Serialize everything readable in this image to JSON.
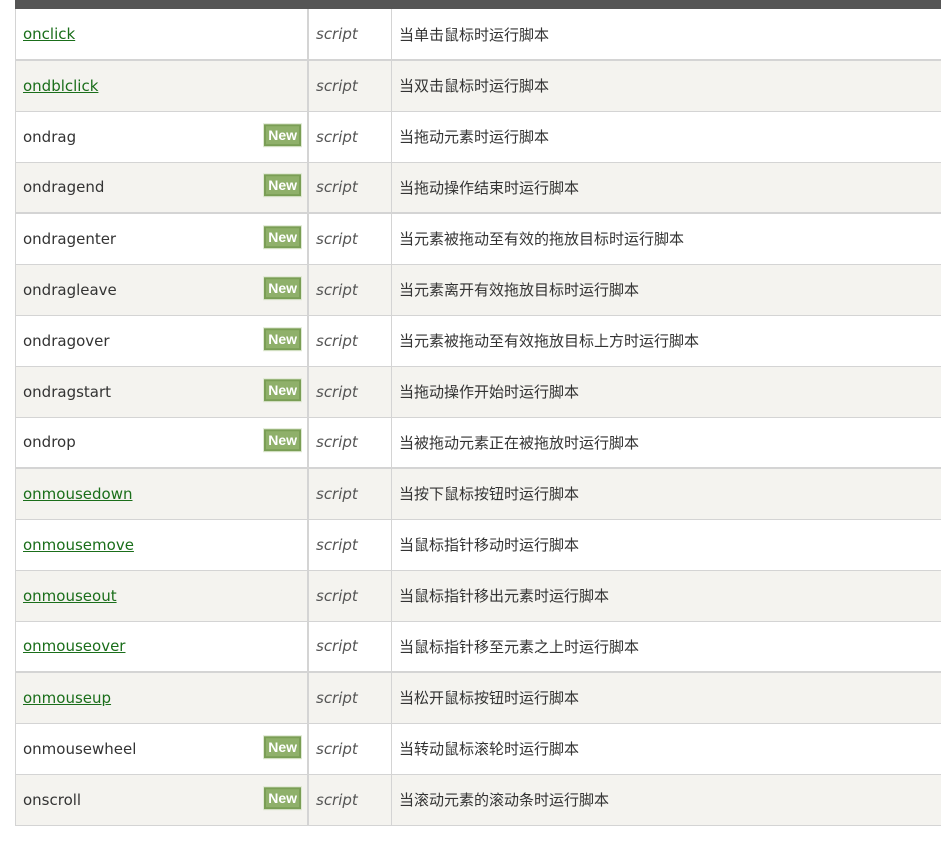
{
  "table": {
    "column_type_hint": "script",
    "rows": [
      {
        "attr": "onclick",
        "link": true,
        "new": false,
        "value": "script",
        "desc": "当单击鼠标时运行脚本"
      },
      {
        "attr": "ondblclick",
        "link": true,
        "new": false,
        "value": "script",
        "desc": "当双击鼠标时运行脚本"
      },
      {
        "attr": "ondrag",
        "link": false,
        "new": true,
        "value": "script",
        "desc": "当拖动元素时运行脚本"
      },
      {
        "attr": "ondragend",
        "link": false,
        "new": true,
        "value": "script",
        "desc": "当拖动操作结束时运行脚本"
      },
      {
        "attr": "ondragenter",
        "link": false,
        "new": true,
        "value": "script",
        "desc": "当元素被拖动至有效的拖放目标时运行脚本"
      },
      {
        "attr": "ondragleave",
        "link": false,
        "new": true,
        "value": "script",
        "desc": "当元素离开有效拖放目标时运行脚本"
      },
      {
        "attr": "ondragover",
        "link": false,
        "new": true,
        "value": "script",
        "desc": "当元素被拖动至有效拖放目标上方时运行脚本"
      },
      {
        "attr": "ondragstart",
        "link": false,
        "new": true,
        "value": "script",
        "desc": "当拖动操作开始时运行脚本"
      },
      {
        "attr": "ondrop",
        "link": false,
        "new": true,
        "value": "script",
        "desc": "当被拖动元素正在被拖放时运行脚本"
      },
      {
        "attr": "onmousedown",
        "link": true,
        "new": false,
        "value": "script",
        "desc": "当按下鼠标按钮时运行脚本"
      },
      {
        "attr": "onmousemove",
        "link": true,
        "new": false,
        "value": "script",
        "desc": "当鼠标指针移动时运行脚本"
      },
      {
        "attr": "onmouseout",
        "link": true,
        "new": false,
        "value": "script",
        "desc": "当鼠标指针移出元素时运行脚本"
      },
      {
        "attr": "onmouseover",
        "link": true,
        "new": false,
        "value": "script",
        "desc": "当鼠标指针移至元素之上时运行脚本"
      },
      {
        "attr": "onmouseup",
        "link": true,
        "new": false,
        "value": "script",
        "desc": "当松开鼠标按钮时运行脚本"
      },
      {
        "attr": "onmousewheel",
        "link": false,
        "new": true,
        "value": "script",
        "desc": "当转动鼠标滚轮时运行脚本"
      },
      {
        "attr": "onscroll",
        "link": false,
        "new": true,
        "value": "script",
        "desc": "当滚动元素的滚动条时运行脚本"
      }
    ],
    "badge_label": "New"
  },
  "colors": {
    "link": "#1a6e1a",
    "badge": "#8fb06a",
    "header": "#555555",
    "row_alt": "#f4f3ef"
  }
}
